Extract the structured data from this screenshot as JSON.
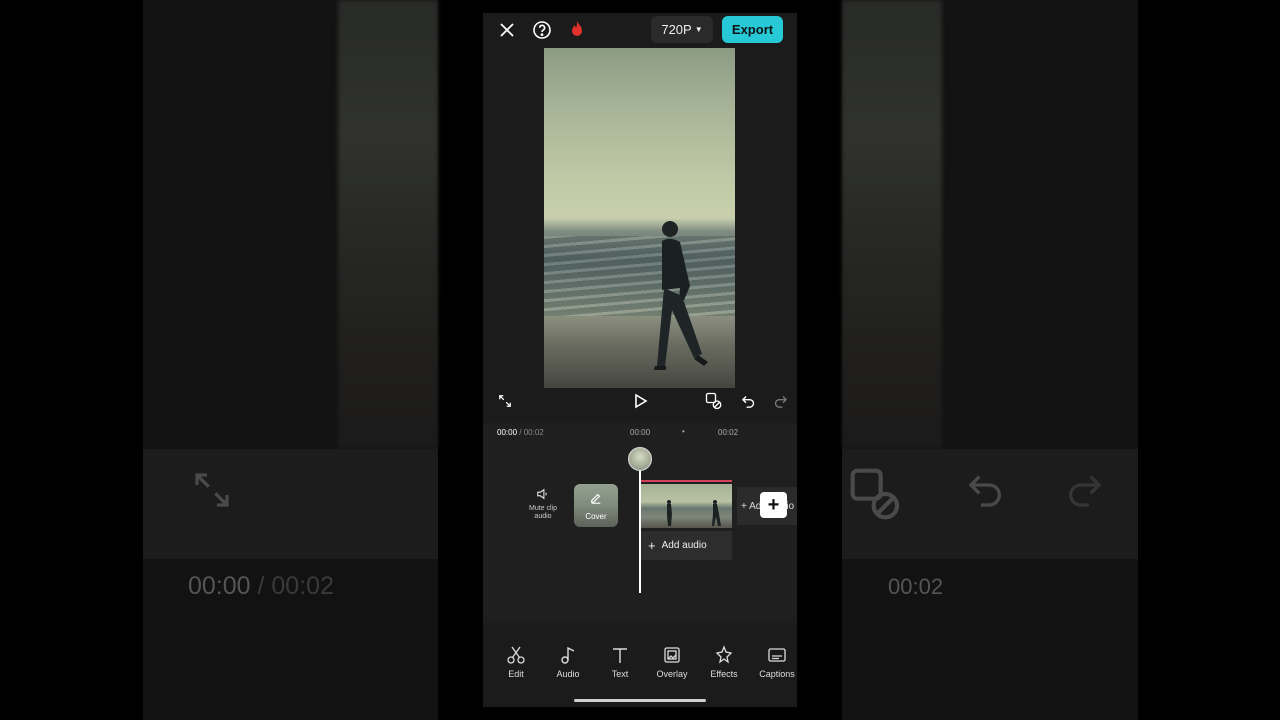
{
  "top_bar": {
    "resolution_label": "720P",
    "export_label": "Export"
  },
  "timeline": {
    "current_time": "00:00",
    "total_time": "/ 00:02",
    "tick_start": "00:00",
    "tick_end": "00:02",
    "mute_label": "Mute clip audio",
    "cover_label": "Cover",
    "add_audio_inline": "+ Add audio",
    "add_audio_label": "Add audio"
  },
  "toolbar": [
    {
      "label": "Edit"
    },
    {
      "label": "Audio"
    },
    {
      "label": "Text"
    },
    {
      "label": "Overlay"
    },
    {
      "label": "Effects"
    },
    {
      "label": "Captions"
    }
  ],
  "background": {
    "time_current": "00:00",
    "time_total": "/ 00:02",
    "time_right": "00:02"
  },
  "colors": {
    "accent": "#27c9d6",
    "clip_border": "#d3415a",
    "panel": "#1b1b1b"
  }
}
